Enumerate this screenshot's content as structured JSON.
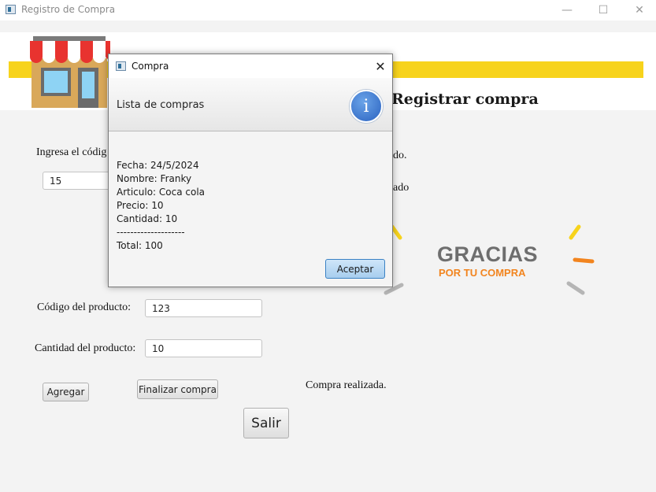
{
  "window": {
    "title": "Registro de Compra",
    "minimize": "—",
    "maximize": "☐",
    "close": "✕"
  },
  "header": {
    "title": "Registrar compra"
  },
  "form": {
    "prompt_code": "Ingresa el códig",
    "prompt_code_tail": "do.",
    "prompt_qty_tail": "ado",
    "code_input_top": "15",
    "product_code_label": "Código del producto:",
    "product_code_value": "123",
    "quantity_label": "Cantidad del producto:",
    "quantity_value": "10",
    "status_text": "Compra realizada."
  },
  "buttons": {
    "add": "Agregar",
    "finish": "Finalizar compra",
    "exit": "Salir"
  },
  "banner": {
    "line1": "GRACIAS",
    "line2": "POR TU COMPRA",
    "accent": "#f2841e"
  },
  "dialog": {
    "title": "Compra",
    "close": "✕",
    "header_text": "Lista de compras",
    "info_icon": "i",
    "lines": {
      "fecha": "Fecha: 24/5/2024",
      "nombre": "Nombre: Franky",
      "articulo": "Articulo: Coca cola",
      "precio": "Precio: 10",
      "cantidad": "Cantidad: 10",
      "separator": "--------------------",
      "total": "Total: 100"
    },
    "ok_label": "Aceptar"
  },
  "colors": {
    "yellow": "#f7d31c",
    "info_blue": "#2a62c0"
  }
}
